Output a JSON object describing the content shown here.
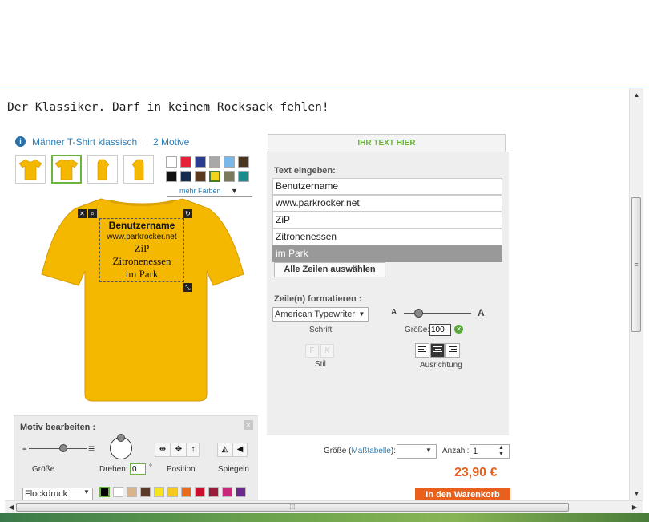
{
  "headline": "Der Klassiker. Darf in keinem Rocksack fehlen!",
  "product": {
    "info_icon": "i",
    "name": "Männer T-Shirt klassisch",
    "separator": "|",
    "motive_count": "2 Motive"
  },
  "colors": {
    "swatches": [
      "#ffffff",
      "#e8213a",
      "#2a3d8f",
      "#a8a8a8",
      "#7bb8e8",
      "#4a3520",
      "#111111",
      "#162b4e",
      "#5a3a1c",
      "#f5d21c",
      "#7a7a5a",
      "#1b8a8a"
    ],
    "selected_index": 9,
    "more_label": "mehr Farben",
    "shirt_color": "#f5b800"
  },
  "design": {
    "lines": [
      "Benutzername",
      "www.parkrocker.net",
      "ZiP",
      "Zitronenessen",
      "im Park"
    ]
  },
  "motiv": {
    "title": "Motiv bearbeiten :",
    "close": "×",
    "size_label": "Größe",
    "rotate_label": "Drehen:",
    "rotate_value": "0",
    "degree": "°",
    "position_label": "Position",
    "mirror_label": "Spiegeln",
    "print_type": "Flockdruck",
    "flock_colors": [
      "#000000",
      "#ffffff",
      "#d9b38c",
      "#5a3a2a",
      "#f5e31c",
      "#f5c81c",
      "#e86a1c",
      "#c8102e",
      "#9a1c3a",
      "#c8287a",
      "#6a2a8a"
    ]
  },
  "text_panel": {
    "tab_label": "IHR TEXT HIER",
    "enter_label": "Text eingeben:",
    "lines": [
      "Benutzername",
      "www.parkrocker.net",
      "ZiP",
      "Zitronenessen",
      "im Park"
    ],
    "selected_line": 4,
    "select_all_label": "Alle Zeilen auswählen",
    "format_label": "Zeile(n) formatieren :",
    "font_value": "American Typewriter",
    "font_label": "Schrift",
    "size_small": "A",
    "size_big": "A",
    "size_label": "Größe:",
    "size_value": "100",
    "bold_label": "F",
    "italic_label": "K",
    "style_label": "Stil",
    "align_label": "Ausrichtung",
    "align_selected": "center"
  },
  "purchase": {
    "size_label": "Größe (",
    "size_link": "Maßtabelle",
    "size_label_end": "):",
    "qty_label": "Anzahl:",
    "qty_value": "1",
    "price": "23,90 €",
    "cart_label": "In den Warenkorb"
  },
  "scrollbar": {
    "grip": "≡",
    "hgrip": "⁞⁞⁞"
  }
}
